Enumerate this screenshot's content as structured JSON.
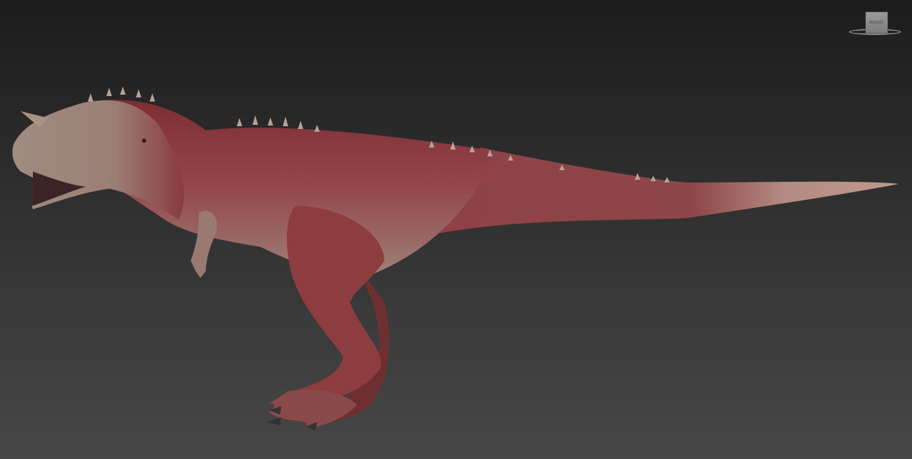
{
  "viewport": {
    "viewcube_face_label": "RIGHT",
    "model_name_icon": "carnotaurus-model"
  },
  "colors": {
    "background_top": "#1c1c1c",
    "background_bottom": "#474747",
    "skin_red": "#8e3a3c",
    "skin_belly": "#a08878"
  }
}
